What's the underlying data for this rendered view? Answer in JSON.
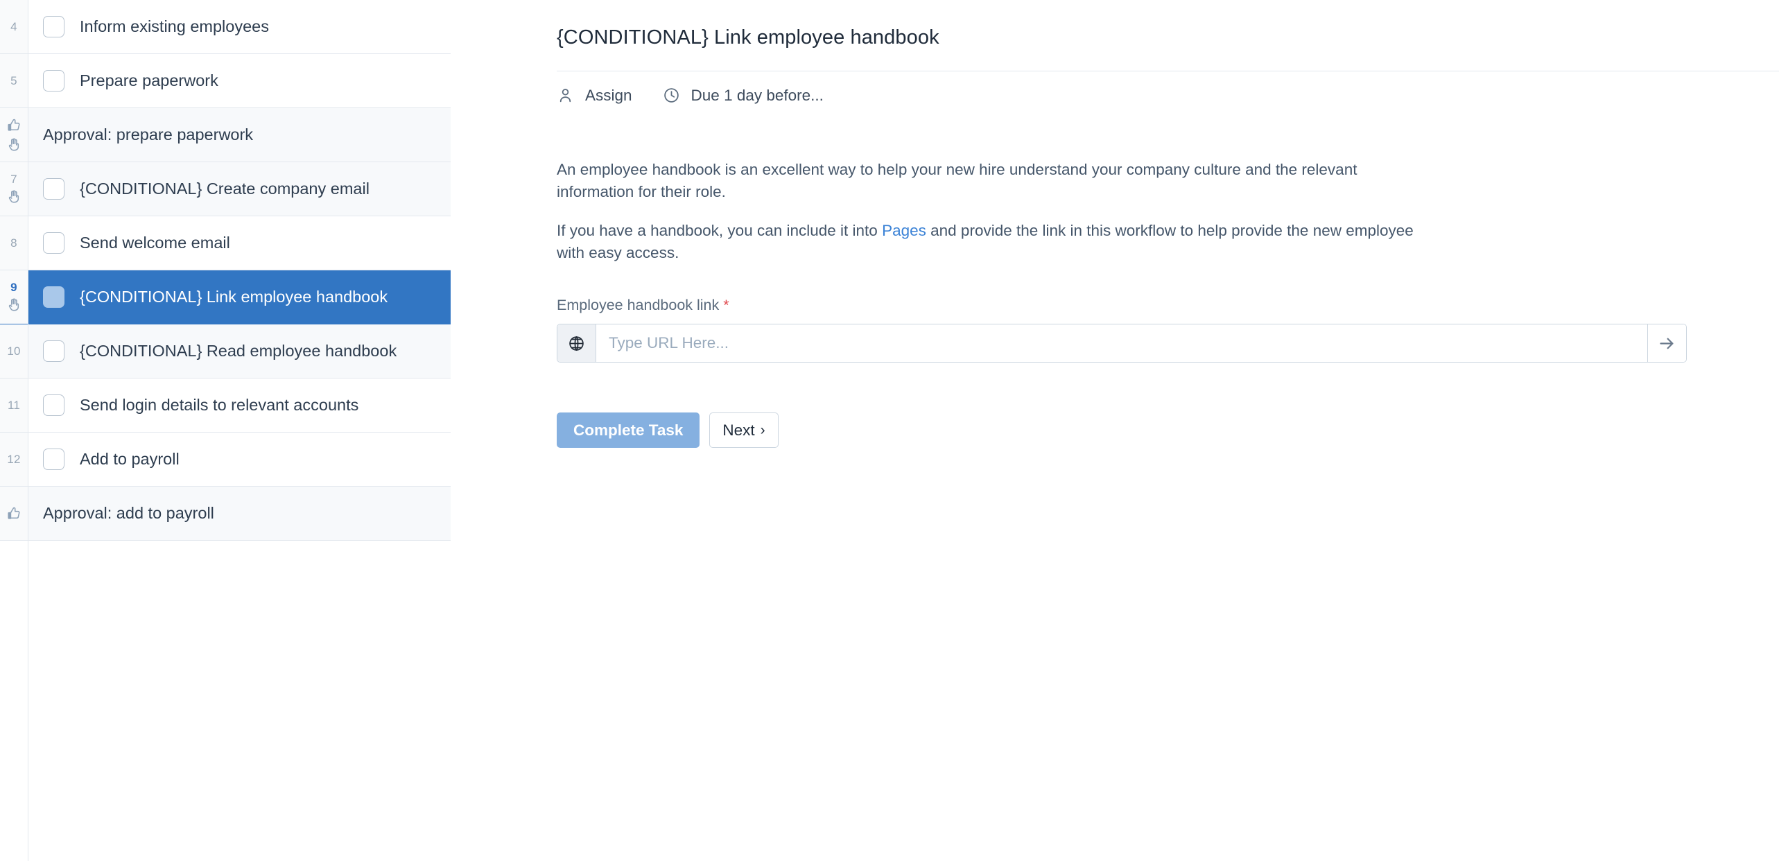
{
  "checklist": {
    "rows": [
      {
        "number": "4",
        "label": "Inform existing employees",
        "type": "task",
        "checked": false,
        "selected": false,
        "tinted": false,
        "gutter_icons": []
      },
      {
        "number": "5",
        "label": "Prepare paperwork",
        "type": "task",
        "checked": false,
        "selected": false,
        "tinted": false,
        "gutter_icons": []
      },
      {
        "number": "",
        "label": "Approval: prepare paperwork",
        "type": "approval",
        "checked": false,
        "selected": false,
        "tinted": true,
        "gutter_icons": [
          "thumbs-up-icon",
          "stop-hand-icon"
        ]
      },
      {
        "number": "7",
        "label": "{CONDITIONAL} Create company email",
        "type": "task",
        "checked": false,
        "selected": false,
        "tinted": true,
        "gutter_icons": [
          "stop-hand-icon"
        ]
      },
      {
        "number": "8",
        "label": "Send welcome email",
        "type": "task",
        "checked": false,
        "selected": false,
        "tinted": false,
        "gutter_icons": []
      },
      {
        "number": "9",
        "label": "{CONDITIONAL} Link employee handbook",
        "type": "task",
        "checked": true,
        "selected": true,
        "tinted": false,
        "gutter_icons": [
          "stop-hand-icon"
        ]
      },
      {
        "number": "10",
        "label": "{CONDITIONAL} Read employee handbook",
        "type": "task",
        "checked": false,
        "selected": false,
        "tinted": true,
        "gutter_icons": []
      },
      {
        "number": "11",
        "label": "Send login details to relevant accounts",
        "type": "task",
        "checked": false,
        "selected": false,
        "tinted": false,
        "gutter_icons": []
      },
      {
        "number": "12",
        "label": "Add to payroll",
        "type": "task",
        "checked": false,
        "selected": false,
        "tinted": false,
        "gutter_icons": []
      },
      {
        "number": "",
        "label": "Approval: add to payroll",
        "type": "approval",
        "checked": false,
        "selected": false,
        "tinted": true,
        "gutter_icons": [
          "thumbs-up-icon"
        ]
      }
    ]
  },
  "detail": {
    "title": "{CONDITIONAL} Link employee handbook",
    "meta": {
      "assign_label": "Assign",
      "assign_icon": "person-icon",
      "due_label": "Due 1 day before...",
      "due_icon": "clock-icon"
    },
    "body": {
      "paragraph1": "An employee handbook is an excellent way to help your new hire understand your company culture and the relevant information for their role.",
      "paragraph2_before": "If you have a handbook, you can include it into ",
      "paragraph2_link": "Pages",
      "paragraph2_after": " and provide the link in this workflow to help provide the new employee with easy access."
    },
    "field": {
      "label": "Employee handbook link",
      "required_marker": "*",
      "prefix_icon": "globe-icon",
      "placeholder": "Type URL Here...",
      "value": "",
      "submit_icon": "arrow-right-icon"
    },
    "actions": {
      "complete_label": "Complete Task",
      "next_label": "Next",
      "next_chevron": "›"
    }
  },
  "colors": {
    "selected_row": "#3276c3",
    "accent_link": "#3b82d6",
    "complete_button": "#85b0e0",
    "required_star": "#e0484d",
    "border": "#e3e8ee"
  }
}
